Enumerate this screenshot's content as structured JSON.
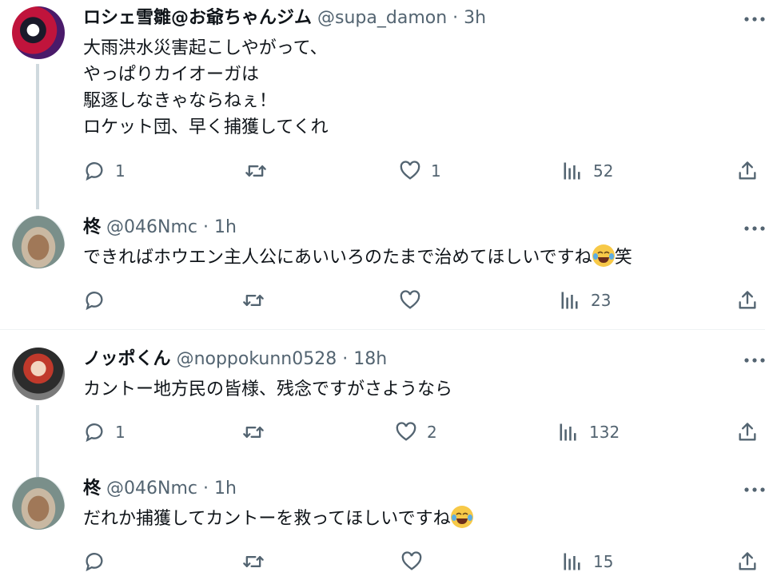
{
  "tweets": [
    {
      "name": "ロシェ雪雛@お爺ちゃんジム",
      "meta": "@supa_damon · 3h",
      "lines": [
        "大雨洪水災害起こしやがって、",
        "やっぱりカイオーガは",
        "駆逐しなきゃならねぇ！",
        "ロケット団、早く捕獲してくれ"
      ],
      "reply_count": "1",
      "like_count": "1",
      "views": "52"
    },
    {
      "name": "柊",
      "meta": "@046Nmc · 1h",
      "text_before": "できればホウエン主人公にあいいろのたまで治めてほしいですね",
      "text_after": "笑",
      "reply_count": "",
      "like_count": "",
      "views": "23"
    },
    {
      "name": "ノッポくん",
      "meta": "@noppokunn0528 · 18h",
      "text": "カントー地方民の皆様、残念ですがさようなら",
      "reply_count": "1",
      "like_count": "2",
      "views": "132"
    },
    {
      "name": "柊",
      "meta": "@046Nmc · 1h",
      "text_before": "だれか捕獲してカントーを救ってほしいですね",
      "reply_count": "",
      "like_count": "",
      "views": "15"
    }
  ],
  "icons": [
    "reply-icon",
    "retweet-icon",
    "like-icon",
    "views-icon",
    "share-icon",
    "more-icon",
    "tears-of-joy-emoji"
  ],
  "colors": {
    "text": "#0f1419",
    "secondary": "#536471",
    "thread_line": "#cfd9de",
    "divider": "#eff3f4"
  }
}
